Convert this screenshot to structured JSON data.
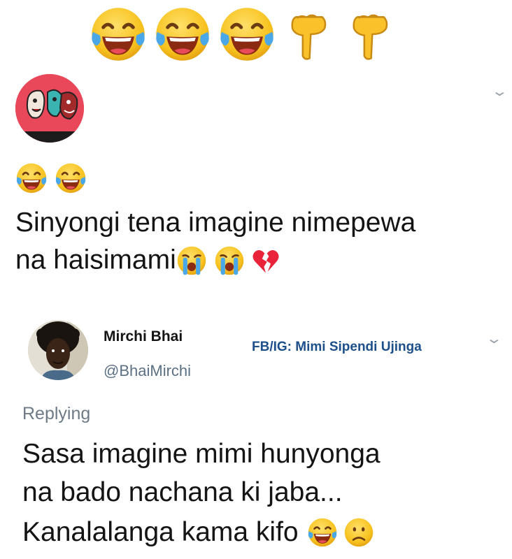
{
  "top_emojis": [
    "face-with-tears-of-joy-icon",
    "face-with-tears-of-joy-icon",
    "face-with-tears-of-joy-icon",
    "backhand-index-pointing-down-icon",
    "backhand-index-pointing-down-icon"
  ],
  "first_tweet": {
    "avatar_icon": "cartoon-faces-avatar",
    "lead_emojis": [
      "face-with-tears-of-joy-icon",
      "face-with-tears-of-joy-icon"
    ],
    "text_line1": "Sinyongi tena imagine nimepewa",
    "text_line2": "na haisimami",
    "trailing_emojis": [
      "loudly-crying-face-icon",
      "loudly-crying-face-icon",
      "broken-heart-icon"
    ]
  },
  "reply_tweet": {
    "name": "Mirchi Bhai",
    "handle": "@BhaiMirchi",
    "watermark": "FB/IG: Mimi Sipendi Ujinga",
    "replying_label": "Replying",
    "line1": "Sasa imagine mimi hunyonga",
    "line2": "na bado nachana ki jaba...",
    "line3": "Kanalalanga kama kifo",
    "trailing_emojis": [
      "face-with-tears-of-joy-icon",
      "frowning-face-icon"
    ]
  },
  "colors": {
    "emoji_yellow": "#f7c21e",
    "tear_blue": "#4aa8e8",
    "heart_red": "#e8233a",
    "watermark_blue": "#1d4f8a"
  }
}
